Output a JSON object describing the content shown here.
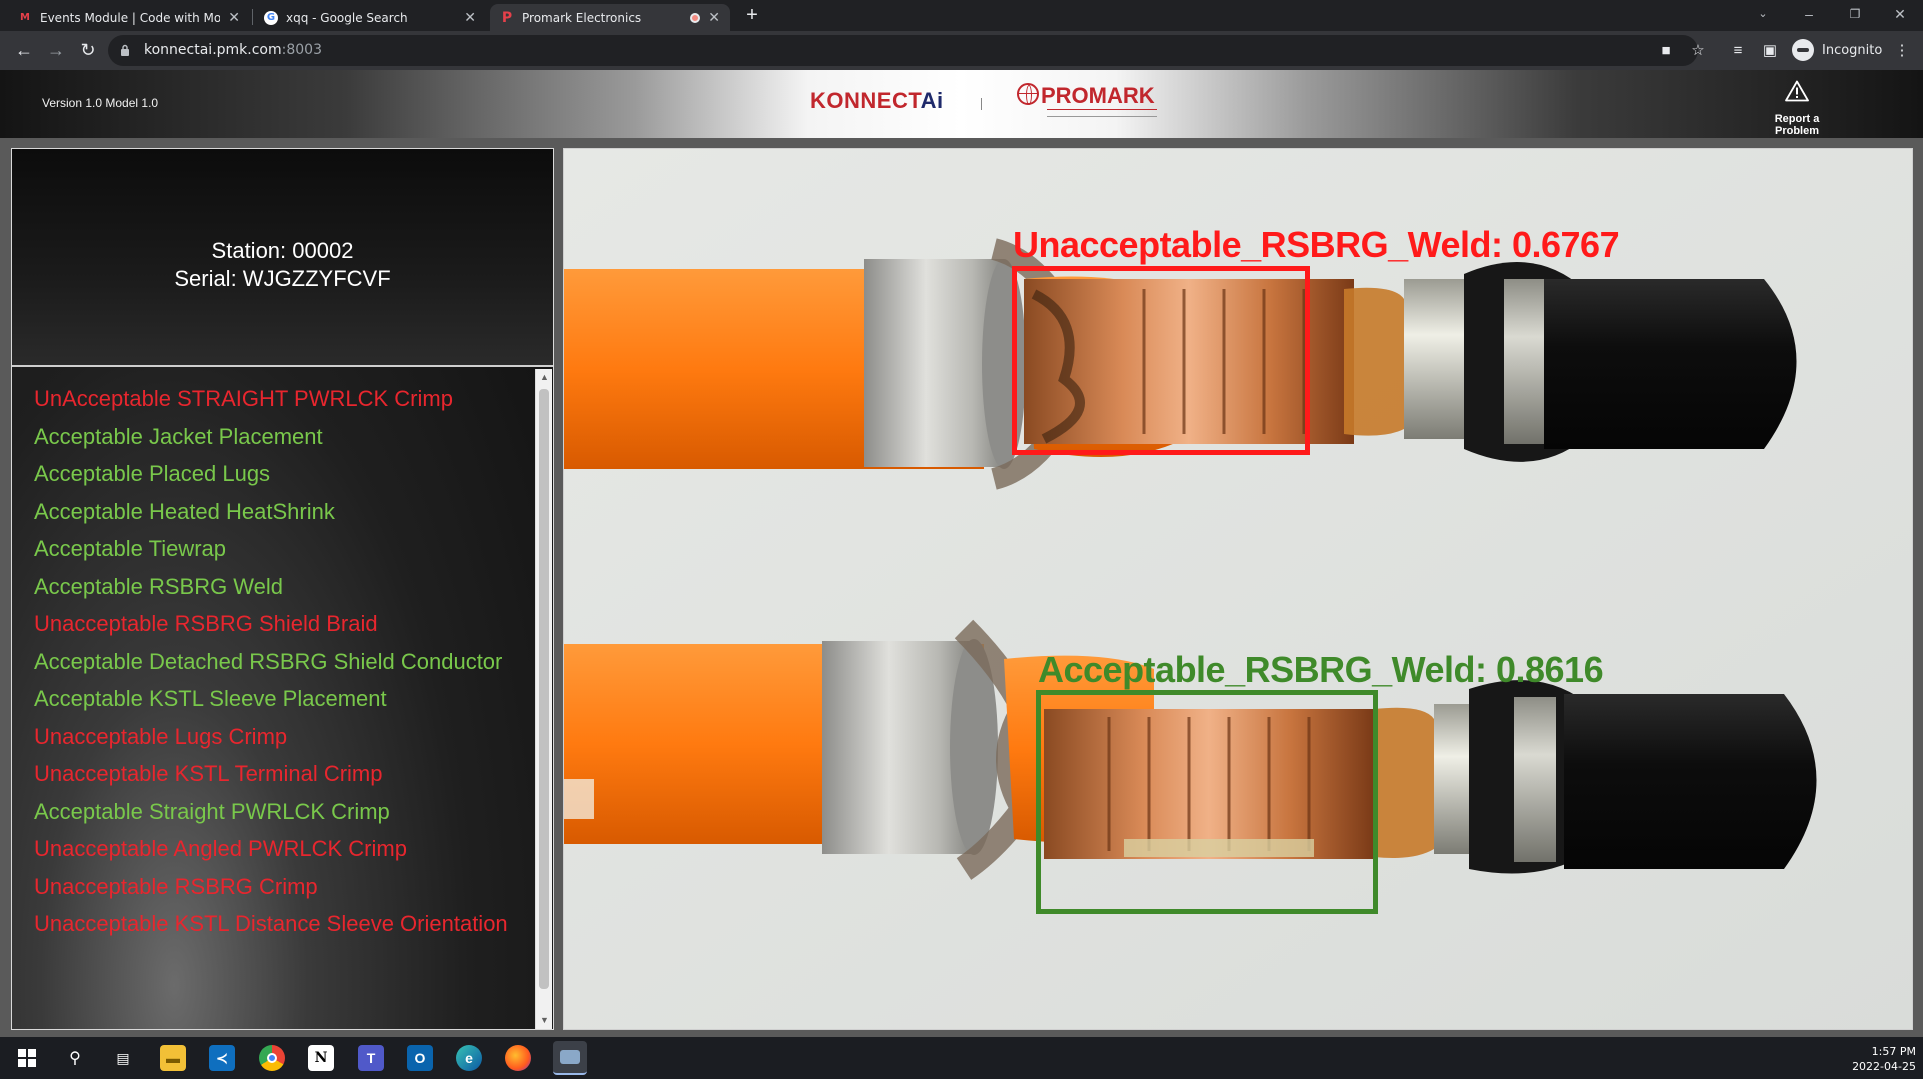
{
  "browser": {
    "tabs": [
      {
        "title": "Events Module | Code with Mosh",
        "favicon": "mosh-icon",
        "active": false
      },
      {
        "title": "xqq - Google Search",
        "favicon": "google-icon",
        "active": false
      },
      {
        "title": "Promark Electronics",
        "favicon": "promark-icon",
        "active": true
      }
    ],
    "url_host": "konnectai.pmk.com",
    "url_port": ":8003",
    "profile_label": "Incognito"
  },
  "header": {
    "version": "Version 1.0 Model 1.0",
    "brand_left": "KONNECT",
    "brand_left_suffix": "Ai",
    "brand_right": "PROMARK",
    "report_label": "Report a Problem"
  },
  "station": {
    "station_line": "Station: 00002",
    "serial_line": "Serial: WJGZZYFCVF"
  },
  "inspections": [
    {
      "text": "UnAcceptable STRAIGHT PWRLCK Crimp",
      "status": "bad"
    },
    {
      "text": "Acceptable Jacket Placement",
      "status": "ok"
    },
    {
      "text": "Acceptable Placed Lugs",
      "status": "ok"
    },
    {
      "text": "Acceptable Heated HeatShrink",
      "status": "ok"
    },
    {
      "text": "Acceptable Tiewrap",
      "status": "ok"
    },
    {
      "text": "Acceptable RSBRG Weld",
      "status": "ok"
    },
    {
      "text": "Unacceptable RSBRG Shield Braid",
      "status": "bad"
    },
    {
      "text": "Acceptable Detached RSBRG Shield Conductor",
      "status": "ok"
    },
    {
      "text": "Acceptable KSTL Sleeve Placement",
      "status": "ok"
    },
    {
      "text": "Unacceptable Lugs Crimp",
      "status": "bad"
    },
    {
      "text": "Unacceptable KSTL Terminal Crimp",
      "status": "bad"
    },
    {
      "text": "Acceptable Straight PWRLCK Crimp",
      "status": "ok"
    },
    {
      "text": "Unacceptable Angled PWRLCK Crimp",
      "status": "bad"
    },
    {
      "text": "Unacceptable RSBRG Crimp",
      "status": "bad"
    },
    {
      "text": "Unacceptable KSTL Distance Sleeve Orientation",
      "status": "bad"
    }
  ],
  "detections": [
    {
      "label": "Unacceptable_RSBRG_Weld:",
      "score": "0.6767",
      "color": "#ff1a1a"
    },
    {
      "label": "Acceptable_RSBRG_Weld:",
      "score": "0.8616",
      "color": "#3f8a2a"
    }
  ],
  "colors": {
    "acceptable": "#79c84b",
    "unacceptable": "#e8262e",
    "brand_red": "#c1272d"
  },
  "taskbar": {
    "apps": [
      "windows-start-icon",
      "search-icon",
      "task-view-icon",
      "file-explorer-icon",
      "vscode-icon",
      "chrome-icon",
      "notion-icon",
      "teams-icon",
      "outlook-icon",
      "edge-icon",
      "firefox-icon",
      "app-icon"
    ],
    "time": "1:57 PM",
    "date": "2022-04-25"
  }
}
